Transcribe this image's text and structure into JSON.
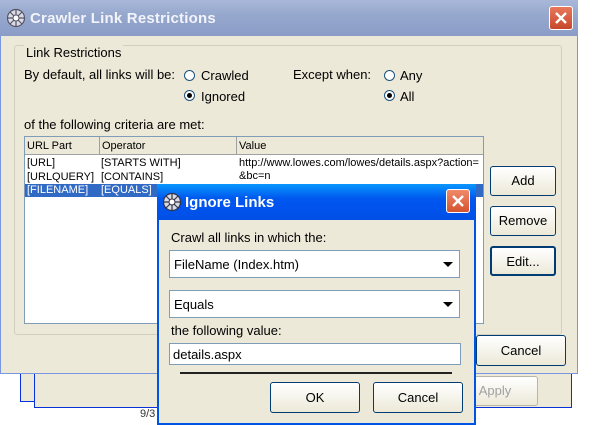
{
  "main_window": {
    "title": "Crawler Link Restrictions",
    "group_label": "Link Restrictions",
    "default_label": "By default, all links will be:",
    "default_options": [
      {
        "label": "Crawled",
        "selected": false
      },
      {
        "label": "Ignored",
        "selected": true
      }
    ],
    "except_label": "Except when:",
    "except_options": [
      {
        "label": "Any",
        "selected": false
      },
      {
        "label": "All",
        "selected": true
      }
    ],
    "criteria_label": "of the following criteria are met:",
    "table": {
      "columns": [
        "URL Part",
        "Operator",
        "Value"
      ],
      "rows": [
        {
          "url_part": "[URL]",
          "operator": "[STARTS WITH]",
          "value": "http://www.lowes.com/lowes/details.aspx?action=",
          "value2": "&bc=n",
          "selected": false
        },
        {
          "url_part": "[URLQUERY]",
          "operator": "[CONTAINS]",
          "value": "",
          "selected": false
        },
        {
          "url_part": "[FILENAME]",
          "operator": "[EQUALS]",
          "value": "",
          "selected": true
        }
      ]
    },
    "buttons": {
      "add": "Add",
      "remove": "Remove",
      "edit": "Edit...",
      "cancel": "Cancel"
    }
  },
  "background_window": {
    "apply_label": "Apply",
    "fragment_text": "9/3"
  },
  "dialog": {
    "title": "Ignore Links",
    "prompt": "Crawl all links in which the:",
    "url_part_selected": "FileName (Index.htm)",
    "operator_selected": "Equals",
    "value_label": "the following value:",
    "value": "details.aspx",
    "ok_label": "OK",
    "cancel_label": "Cancel"
  },
  "colors": {
    "window_face": "#ece9d8",
    "inactive_title": "#97a8ce",
    "active_title": "#0058ee",
    "selection": "#316ac5",
    "close_red": "#d4532f"
  },
  "icons": [
    "app-icon",
    "close-icon",
    "combo-arrow-icon"
  ]
}
